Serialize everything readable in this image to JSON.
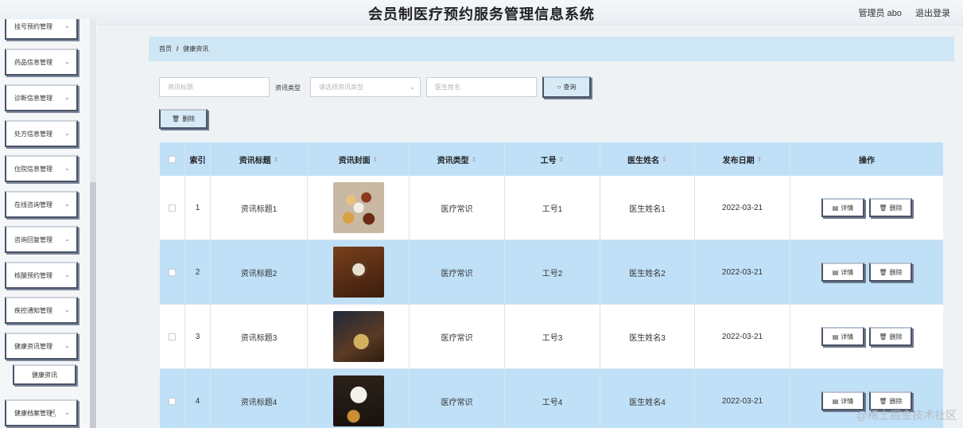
{
  "header": {
    "title": "会员制医疗预约服务管理信息系统",
    "user": "管理员 abo",
    "logout": "退出登录"
  },
  "sidebar": {
    "items": [
      {
        "label": "挂号预约管理"
      },
      {
        "label": "药品信息管理"
      },
      {
        "label": "诊断信息管理"
      },
      {
        "label": "处方信息管理"
      },
      {
        "label": "住院信息管理"
      },
      {
        "label": "在线咨询管理"
      },
      {
        "label": "咨询回复管理"
      },
      {
        "label": "核酸预约管理"
      },
      {
        "label": "疾控通知管理"
      },
      {
        "label": "健康资讯管理"
      },
      {
        "label": "健康档案管理"
      }
    ],
    "sub_item": "健康资讯"
  },
  "breadcrumb": {
    "home": "首页",
    "separator": "/",
    "current": "健康资讯"
  },
  "search": {
    "title_placeholder": "资讯标题",
    "type_label": "资讯类型",
    "type_placeholder": "请选择资讯类型",
    "doctor_placeholder": "医生姓名",
    "query_label": "查询",
    "delete_label": "删除"
  },
  "table": {
    "headers": {
      "index": "索引",
      "title": "资讯标题",
      "cover": "资讯封面",
      "type": "资讯类型",
      "no": "工号",
      "doctor": "医生姓名",
      "date": "发布日期",
      "ops": "操作"
    },
    "rows": [
      {
        "index": "1",
        "title": "资讯标题1",
        "type": "医疗常识",
        "no": "工号1",
        "doctor": "医生姓名1",
        "date": "2022-03-21"
      },
      {
        "index": "2",
        "title": "资讯标题2",
        "type": "医疗常识",
        "no": "工号2",
        "doctor": "医生姓名2",
        "date": "2022-03-21"
      },
      {
        "index": "3",
        "title": "资讯标题3",
        "type": "医疗常识",
        "no": "工号3",
        "doctor": "医生姓名3",
        "date": "2022-03-21"
      },
      {
        "index": "4",
        "title": "资讯标题4",
        "type": "医疗常识",
        "no": "工号4",
        "doctor": "医生姓名4",
        "date": "2022-03-21"
      }
    ],
    "detail_label": "详情",
    "delete_label": "删除"
  },
  "watermark": "@稀土掘金技术社区"
}
